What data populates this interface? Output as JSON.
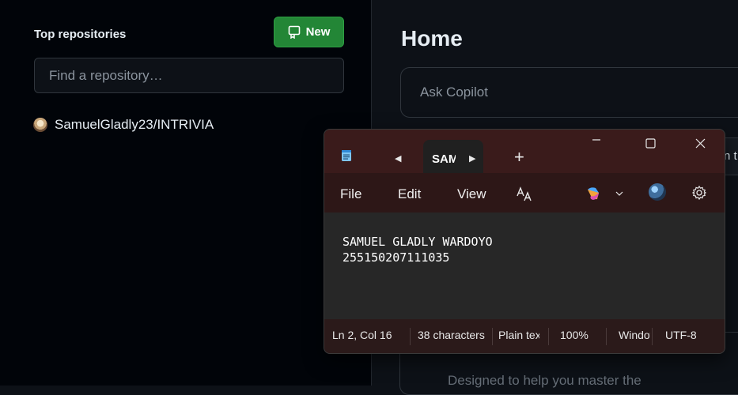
{
  "sidebar": {
    "title": "Top repositories",
    "new_button": "New",
    "search_placeholder": "Find a repository…",
    "repos": [
      {
        "name": "SamuelGladly23/INTRIVIA"
      }
    ]
  },
  "main": {
    "title": "Home",
    "copilot_placeholder": "Ask Copilot",
    "partial_chip_text": "n t",
    "behind_subtitle": "Designed to help you master the"
  },
  "notepad": {
    "tab": {
      "label": "SAMUEL GLADLY WARDOYO"
    },
    "menu": {
      "file": "File",
      "edit": "Edit",
      "view": "View"
    },
    "content": {
      "lines": [
        "SAMUEL GLADLY WARDOYO",
        "255150207111035"
      ]
    },
    "status": {
      "position": "Ln 2, Col 16",
      "characters": "38 characters",
      "format": "Plain text",
      "zoom": "100%",
      "line_ending": "Windows (CRLF)",
      "encoding": "UTF-8"
    },
    "icons": {
      "app": "notepad-icon",
      "tab_prev": "caret-left-icon",
      "tab_next": "caret-right-icon",
      "new_tab": "plus-icon",
      "minimize": "minimize-icon",
      "maximize": "maximize-icon",
      "close": "close-icon",
      "font": "font-icon",
      "copilot": "copilot-icon",
      "settings": "gear-icon"
    }
  },
  "colors": {
    "github_bg": "#0d1117",
    "sidebar_bg": "#010409",
    "new_button": "#238636",
    "notepad_titlebar": "#3a1b1b",
    "notepad_editor": "#272727"
  }
}
